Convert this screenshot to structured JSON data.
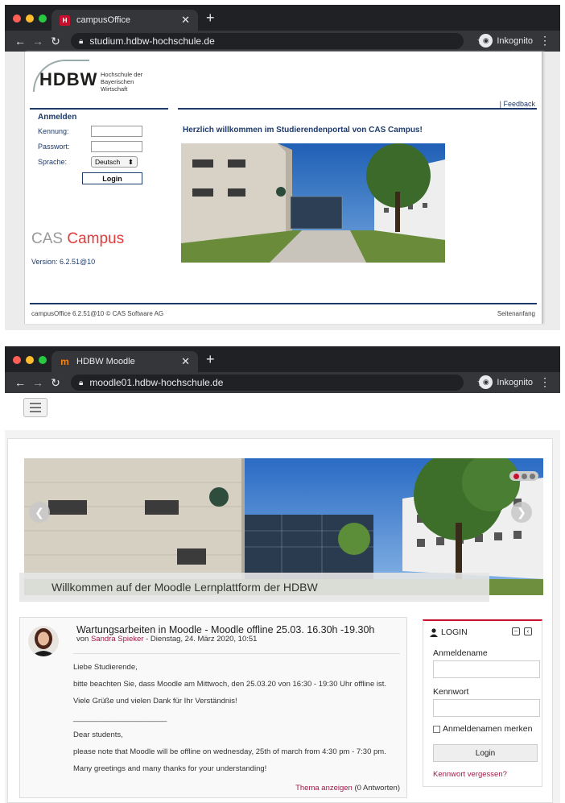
{
  "window1": {
    "tab_title": "campusOffice",
    "url": "studium.hdbw-hochschule.de",
    "incognito_label": "Inkognito",
    "page": {
      "logo_mark": "HDBW",
      "logo_sub_line1": "Hochschule der",
      "logo_sub_line2": "Bayerischen Wirtschaft",
      "feedback": "| Feedback",
      "login_title": "Anmelden",
      "kennung_label": "Kennung:",
      "passwort_label": "Passwort:",
      "sprache_label": "Sprache:",
      "sprache_value": "Deutsch",
      "login_button": "Login",
      "welcome": "Herzlich willkommen im Studierendenportal von CAS Campus!",
      "brand_cas": "CAS",
      "brand_campus": "Campus",
      "version": "Version: 6.2.51@10",
      "footer_left": "campusOffice 6.2.51@10 © CAS Software AG",
      "footer_right": "Seitenanfang"
    }
  },
  "window2": {
    "tab_title": "HDBW Moodle",
    "url": "moodle01.hdbw-hochschule.de",
    "incognito_label": "Inkognito",
    "page": {
      "slide_caption": "Willkommen auf der Moodle Lernplattform der HDBW",
      "news": {
        "title": "Wartungsarbeiten in Moodle - Moodle offline 25.03. 16.30h -19.30h",
        "meta_prefix": "von",
        "author": "Sandra Spieker",
        "meta_suffix": "- Dienstag, 24. März 2020, 10:51",
        "body": [
          "Liebe Studierende,",
          "bitte beachten Sie, dass Moodle am Mittwoch, den 25.03.20 von 16:30 - 19:30 Uhr offline ist.",
          "Viele Grüße und vielen Dank für Ihr Verständnis!",
          "______________________",
          "Dear students,",
          "please note that Moodle will be offline on wednesday, 25th of march from 4:30 pm - 7:30 pm.",
          "Many greetings and many thanks for your understanding!"
        ],
        "discussion_link": "Thema anzeigen",
        "replies": "(0 Antworten)"
      },
      "login": {
        "header": "LOGIN",
        "username_label": "Anmeldename",
        "password_label": "Kennwort",
        "remember_label": "Anmeldenamen merken",
        "button": "Login",
        "forgot": "Kennwort vergessen?"
      }
    }
  },
  "colors": {
    "cas_navy": "#1e3a6a",
    "cas_red": "#e03c3c",
    "moodle_accent": "#a0194a",
    "browser_dark": "#202124"
  }
}
